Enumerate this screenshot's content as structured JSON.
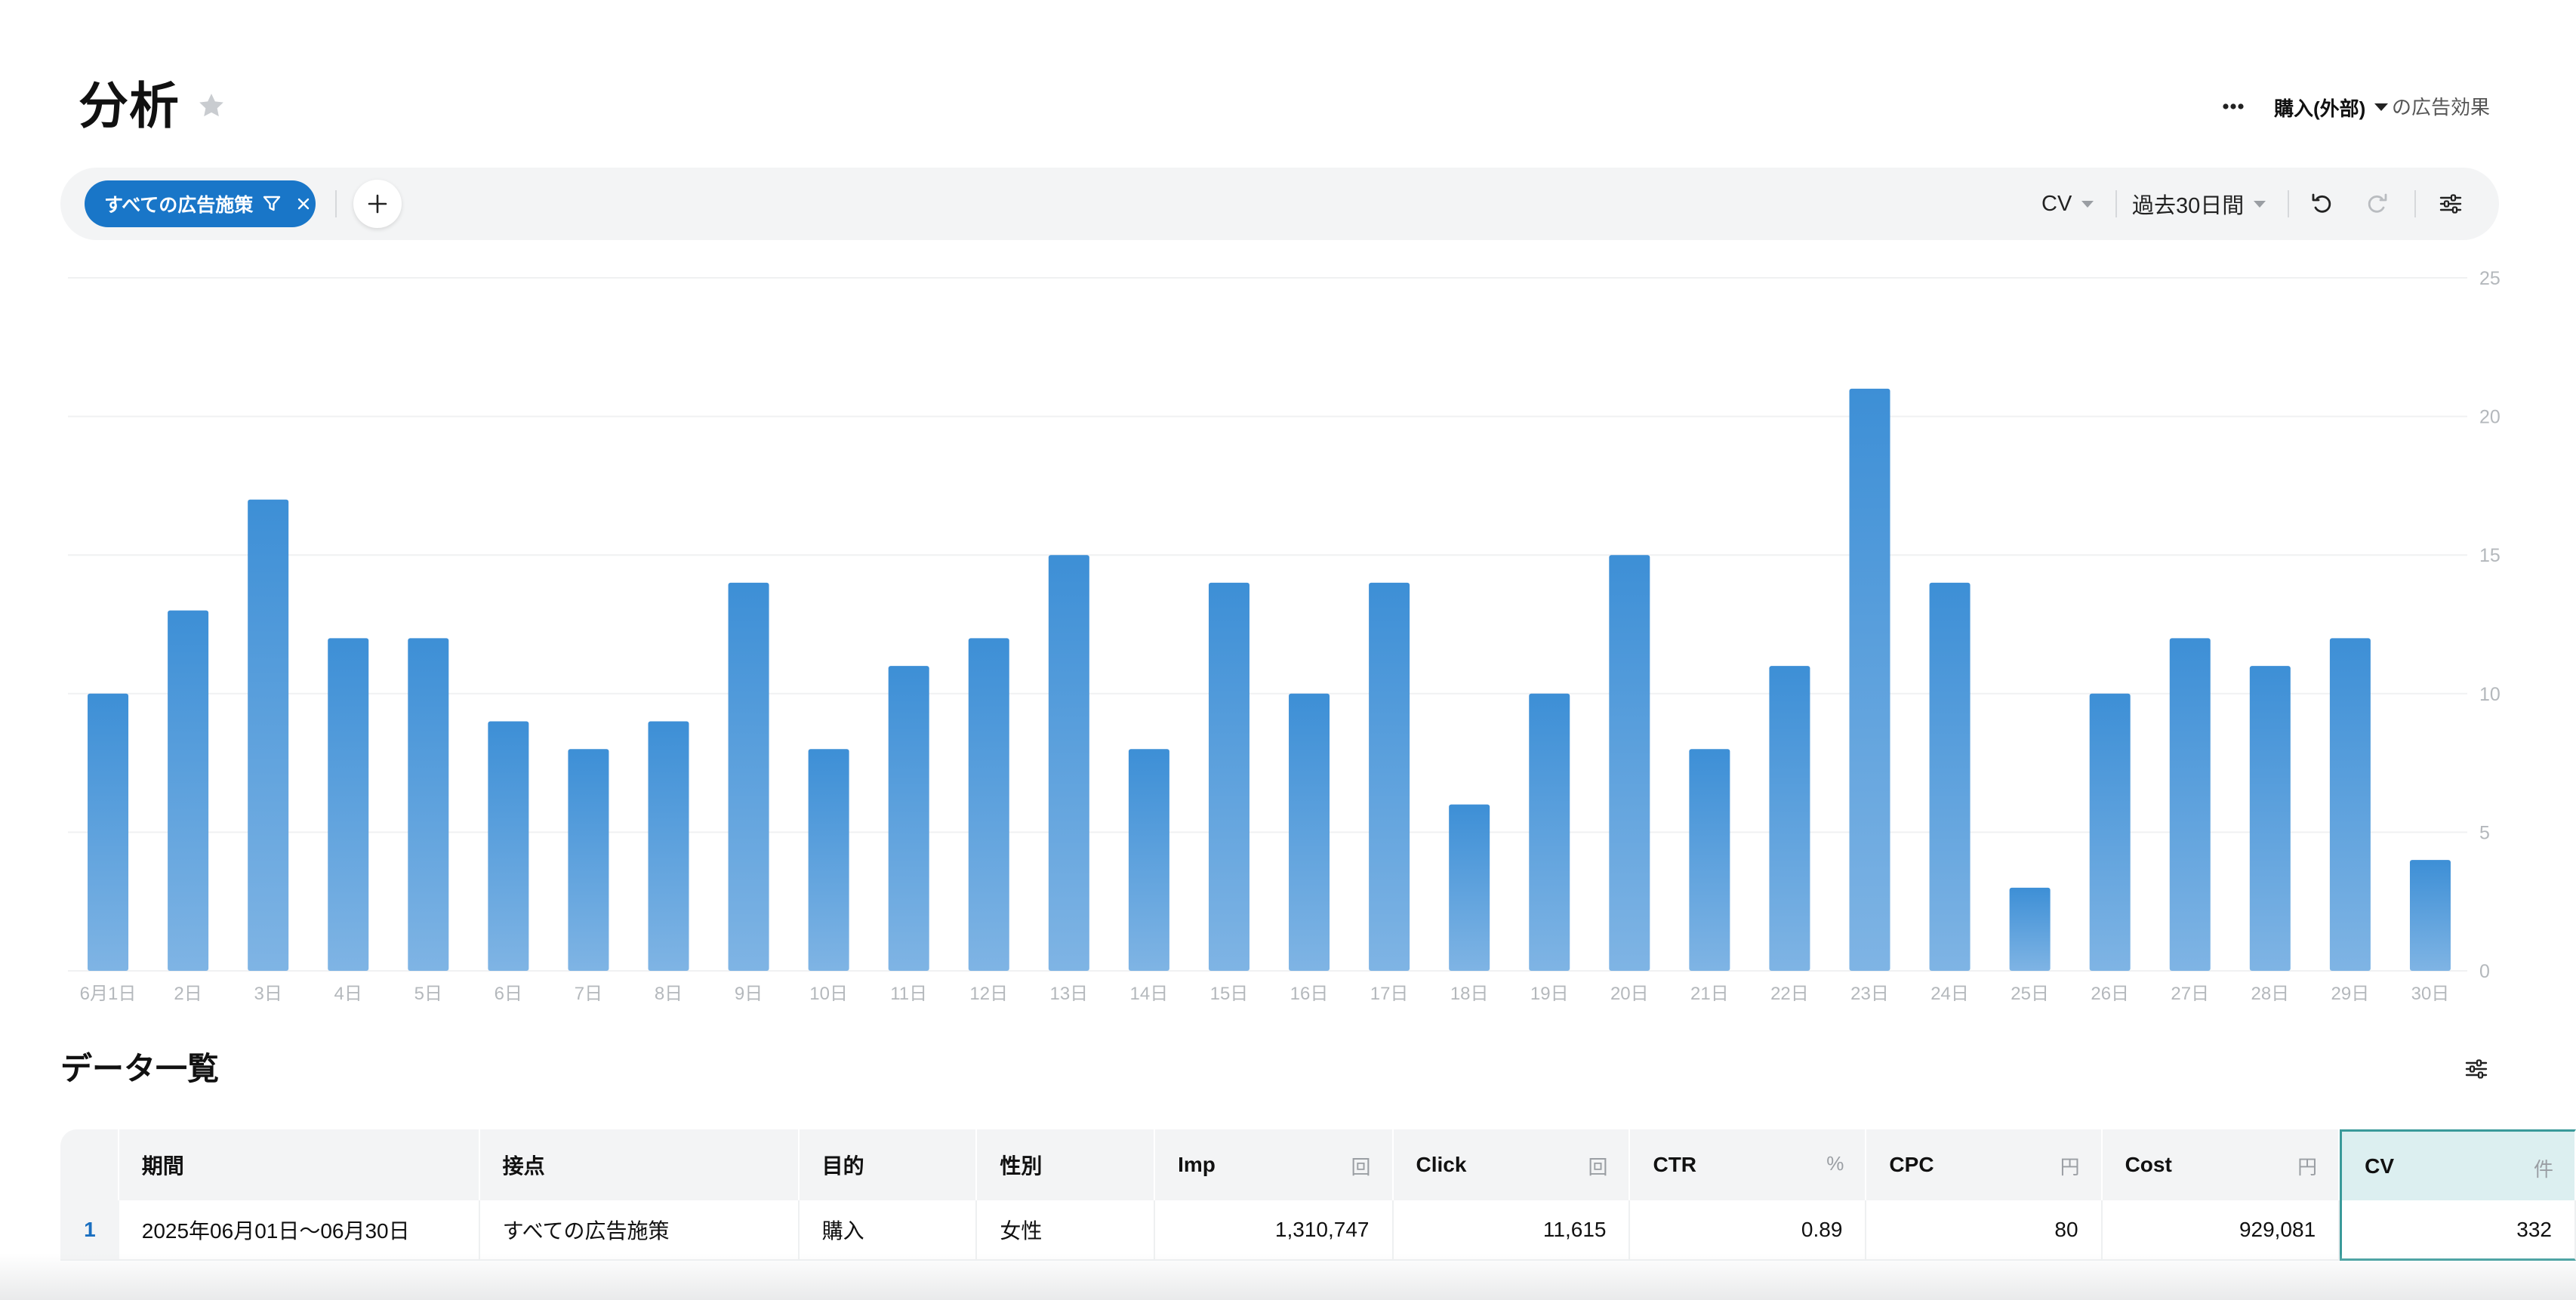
{
  "header": {
    "title": "分析",
    "conversion_select": "購入(外部)",
    "conversion_suffix": "の広告効果"
  },
  "toolbar": {
    "filter_chip_label": "すべての広告施策",
    "metric_select": "CV",
    "range_select": "過去30日間"
  },
  "icons": {
    "favorite": "star-icon",
    "more": "more-icon",
    "filter": "funnel-icon",
    "remove": "close-icon",
    "add": "plus-icon",
    "undo": "undo-icon",
    "redo": "redo-icon",
    "settings": "sliders-icon"
  },
  "colors": {
    "accent": "#1976c8",
    "bar_top": "#3d8fd6",
    "bar_bottom": "#7fb4e4",
    "highlight": "#3a9a9a"
  },
  "chart_data": {
    "type": "bar",
    "categories": [
      "6月1日",
      "2日",
      "3日",
      "4日",
      "5日",
      "6日",
      "7日",
      "8日",
      "9日",
      "10日",
      "11日",
      "12日",
      "13日",
      "14日",
      "15日",
      "16日",
      "17日",
      "18日",
      "19日",
      "20日",
      "21日",
      "22日",
      "23日",
      "24日",
      "25日",
      "26日",
      "27日",
      "28日",
      "29日",
      "30日"
    ],
    "values": [
      10,
      13,
      17,
      12,
      12,
      9,
      8,
      9,
      14,
      8,
      11,
      12,
      15,
      8,
      14,
      10,
      14,
      6,
      10,
      15,
      8,
      11,
      21,
      14,
      3,
      10,
      12,
      11,
      12,
      4
    ],
    "ylim": [
      0,
      25
    ],
    "yticks": [
      0,
      5,
      10,
      15,
      20,
      25
    ],
    "y_axis_side": "right",
    "grid": true
  },
  "table": {
    "title": "データ一覧",
    "columns": [
      {
        "label": "期間",
        "unit": ""
      },
      {
        "label": "接点",
        "unit": ""
      },
      {
        "label": "目的",
        "unit": ""
      },
      {
        "label": "性別",
        "unit": ""
      },
      {
        "label": "Imp",
        "unit": "回"
      },
      {
        "label": "Click",
        "unit": "回"
      },
      {
        "label": "CTR",
        "unit": "%"
      },
      {
        "label": "CPC",
        "unit": "円"
      },
      {
        "label": "Cost",
        "unit": "円"
      },
      {
        "label": "CV",
        "unit": "件"
      }
    ],
    "rows": [
      {
        "index": "1",
        "period": "2025年06月01日〜06月30日",
        "touchpoint": "すべての広告施策",
        "purpose": "購入",
        "gender": "女性",
        "imp": "1,310,747",
        "click": "11,615",
        "ctr": "0.89",
        "cpc": "80",
        "cost": "929,081",
        "cv": "332"
      }
    ]
  }
}
